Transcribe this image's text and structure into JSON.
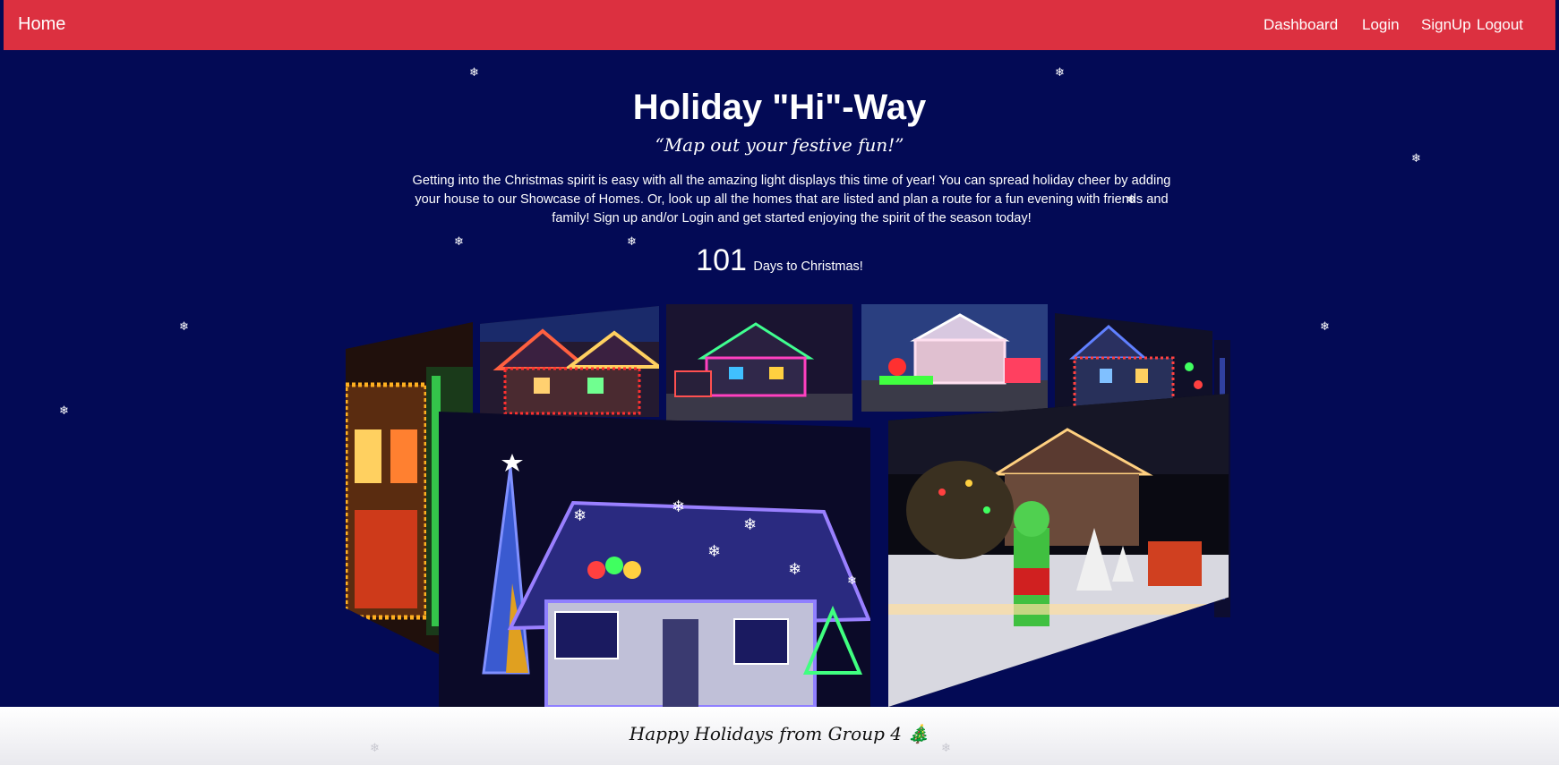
{
  "nav": {
    "brand": "Home",
    "links": [
      "Dashboard",
      "Login",
      "SignUp",
      "Logout"
    ]
  },
  "hero": {
    "title": "Holiday \"Hi\"-Way",
    "tagline": "“Map out your festive fun!”",
    "intro": "Getting into the Christmas spirit is easy with all the amazing light displays this time of year! You can spread holiday cheer by adding your house to our Showcase of Homes. Or, look up all the homes that are listed and plan a route for a fun evening with friends and family! Sign up and/or Login and get started enjoying the spirit of the season today!",
    "countdown": {
      "number": "101",
      "label": "Days to Christmas!"
    }
  },
  "carousel": {
    "photos": [
      "christmas-lights-house-photo",
      "christmas-lights-house-photo",
      "christmas-lights-house-photo",
      "christmas-lights-house-photo",
      "christmas-lights-house-photo",
      "christmas-lights-house-photo",
      "blue-lights-house-photo",
      "grinch-yard-display-photo"
    ]
  },
  "snowflake_glyph": "❄",
  "footer": {
    "text": "Happy Holidays from Group 4 🎄"
  },
  "colors": {
    "navbar": "#dc3040",
    "background": "#030a55",
    "footer": "#ffffff"
  }
}
